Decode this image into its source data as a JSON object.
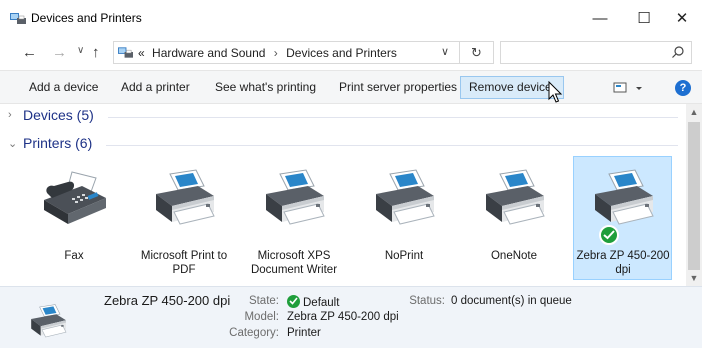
{
  "window": {
    "title": "Devices and Printers",
    "minimize_glyph": "—",
    "maximize_glyph": "☐",
    "close_glyph": "✕"
  },
  "address": {
    "overflow": "«",
    "crumbs": [
      "Hardware and Sound",
      "Devices and Printers"
    ],
    "separator": "›",
    "search_placeholder": ""
  },
  "toolbar": {
    "commands": [
      "Add a device",
      "Add a printer",
      "See what's printing",
      "Print server properties",
      "Remove device"
    ],
    "help_glyph": "?"
  },
  "groups": {
    "devices": "Devices (5)",
    "printers": "Printers (6)"
  },
  "printers": [
    {
      "name": "Fax",
      "icon": "fax-icon"
    },
    {
      "name": "Microsoft Print to PDF",
      "icon": "printer-icon"
    },
    {
      "name": "Microsoft XPS Document Writer",
      "icon": "printer-icon"
    },
    {
      "name": "NoPrint",
      "icon": "printer-icon"
    },
    {
      "name": "OneNote",
      "icon": "printer-icon"
    },
    {
      "name": "Zebra  ZP 450-200 dpi",
      "icon": "printer-icon",
      "selected": true,
      "default": true
    }
  ],
  "details": {
    "name": "Zebra  ZP 450-200 dpi",
    "state_label": "State:",
    "state_value": "Default",
    "model_label": "Model:",
    "model_value": "Zebra  ZP 450-200 dpi",
    "category_label": "Category:",
    "category_value": "Printer",
    "status_label": "Status:",
    "status_value": "0 document(s) in queue"
  },
  "colors": {
    "accent": "#1d6fd1",
    "selection_bg": "#cce8ff",
    "selection_border": "#99d1ff",
    "default_check": "#1f9e3b",
    "group_label": "#1e3287"
  }
}
